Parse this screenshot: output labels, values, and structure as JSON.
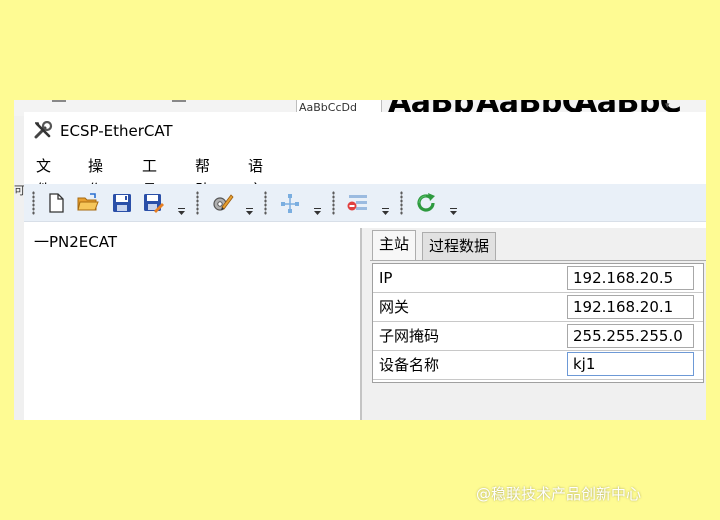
{
  "background_strip": {
    "style_preview_small": "AaBbCcDd",
    "style_preview_large_1": "AaBb",
    "style_preview_large_2": "AaBbC",
    "style_preview_large_3": "AaBbC",
    "left_char": "可"
  },
  "window": {
    "title": "ECSP-EtherCAT",
    "icon": "tools-icon"
  },
  "menu": [
    {
      "label": "文件"
    },
    {
      "label": "操作"
    },
    {
      "label": "工具"
    },
    {
      "label": "帮助"
    },
    {
      "label": "语言"
    }
  ],
  "toolbar": {
    "buttons": [
      {
        "icon": "new-file-icon"
      },
      {
        "icon": "open-folder-icon"
      },
      {
        "icon": "save-icon"
      },
      {
        "icon": "save-as-icon"
      },
      {
        "icon": "settings-icon"
      },
      {
        "icon": "add-node-icon"
      },
      {
        "icon": "remove-node-icon"
      },
      {
        "icon": "refresh-icon"
      }
    ]
  },
  "tree": {
    "items": [
      {
        "label": "一PN2ECAT"
      }
    ]
  },
  "tabs": [
    {
      "label": "主站",
      "active": true
    },
    {
      "label": "过程数据",
      "active": false
    }
  ],
  "properties": [
    {
      "label": "IP",
      "value": "192.168.20.5"
    },
    {
      "label": "网关",
      "value": "192.168.20.1"
    },
    {
      "label": "子网掩码",
      "value": "255.255.255.0"
    },
    {
      "label": "设备名称",
      "value": "kj1"
    }
  ],
  "watermark": "@稳联技术产品创新中心",
  "colors": {
    "background": "#fefb93",
    "toolbar": "#e9f0f8",
    "panel": "#f0f0f0",
    "save_blue": "#2a4fa8",
    "refresh_green": "#2e9a3f"
  }
}
